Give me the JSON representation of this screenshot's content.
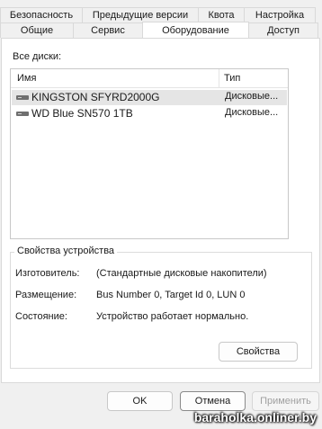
{
  "tabs_row1": [
    "Безопасность",
    "Предыдущие версии",
    "Квота",
    "Настройка"
  ],
  "tabs_row2": [
    "Общие",
    "Сервис",
    "Оборудование",
    "Доступ"
  ],
  "active_tab": "Оборудование",
  "all_disks_label": "Все диски:",
  "list": {
    "columns": [
      "Имя",
      "Тип"
    ],
    "rows": [
      {
        "name": "KINGSTON SFYRD2000G",
        "type": "Дисковые...",
        "icon": "drive-icon",
        "selected": true
      },
      {
        "name": "WD Blue SN570 1TB",
        "type": "Дисковые...",
        "icon": "drive-icon",
        "selected": false
      }
    ]
  },
  "device_properties": {
    "title": "Свойства устройства",
    "manufacturer_label": "Изготовитель:",
    "manufacturer_value": "(Стандартные дисковые накопители)",
    "location_label": "Размещение:",
    "location_value": "Bus Number 0, Target Id 0, LUN 0",
    "status_label": "Состояние:",
    "status_value": "Устройство работает нормально.",
    "properties_button": "Свойства"
  },
  "buttons": {
    "ok": "OK",
    "cancel": "Отмена",
    "apply": "Применить"
  },
  "watermark": "baraholka.onliner.by"
}
